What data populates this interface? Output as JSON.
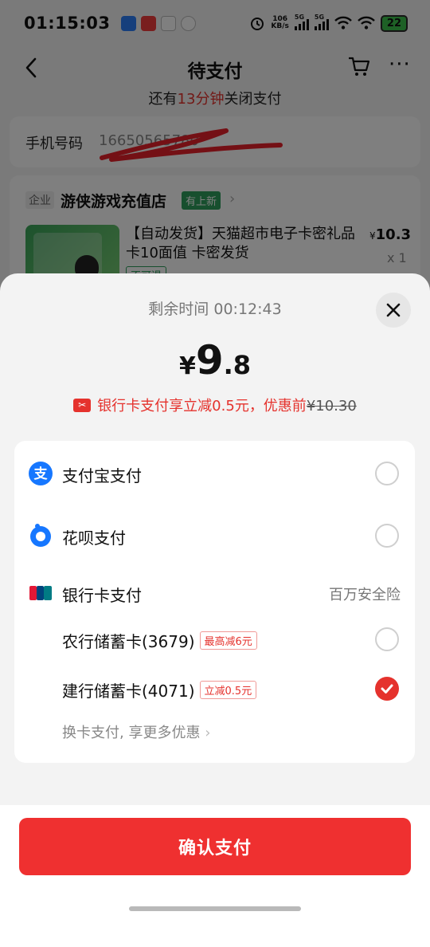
{
  "status_bar": {
    "time": "01:15:03",
    "net_speed": "106",
    "net_unit": "KB/s",
    "sim1": "5G",
    "sim2": "5G",
    "battery": "22"
  },
  "header": {
    "title": "待支付",
    "countdown_prefix": "还有",
    "countdown_minutes": "13分钟",
    "countdown_suffix": "关闭支付"
  },
  "phone": {
    "label": "手机号码",
    "value": "16650565780"
  },
  "shop": {
    "type_tag": "企业",
    "name": "游侠游戏充值店",
    "badge": "有上新",
    "product_title": "【自动发货】天猫超市电子卡密礼品卡10面值 卡密发货",
    "price_symbol": "¥",
    "price": "10.3",
    "quantity": "x 1",
    "product_tag": "不可退"
  },
  "sheet": {
    "remaining_label": "剩余时间",
    "remaining_time": "00:12:43",
    "amount_currency": "¥",
    "amount_int": "9",
    "amount_dec": ".8",
    "discount_text": "银行卡支付享立减0.5元，优惠前",
    "discount_original": "¥10.30",
    "methods": [
      {
        "label": "支付宝支付",
        "icon": "alipay-icon",
        "selected": false
      },
      {
        "label": "花呗支付",
        "icon": "huabei-icon",
        "selected": false
      },
      {
        "label": "银行卡支付",
        "icon": "unionpay-icon",
        "extra": "百万安全险"
      }
    ],
    "cards": [
      {
        "label": "农行储蓄卡(3679)",
        "tag": "最高减6元",
        "selected": false
      },
      {
        "label": "建行储蓄卡(4071)",
        "tag": "立减0.5元",
        "selected": true
      }
    ],
    "more_cards": "换卡支付, 享更多优惠",
    "confirm_label": "确认支付"
  },
  "colors": {
    "accent_red": "#ef3030",
    "price_red": "#e5322d",
    "alipay_blue": "#1677ff",
    "badge_green": "#2f9e5c"
  }
}
